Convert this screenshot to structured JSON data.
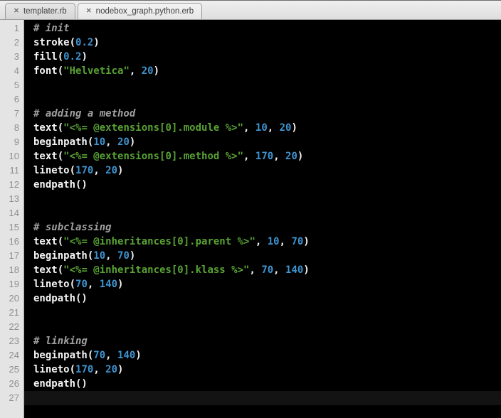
{
  "tabs": {
    "close_glyph": "✕",
    "items": [
      {
        "label": "templater.rb",
        "active": false
      },
      {
        "label": "nodebox_graph.python.erb",
        "active": true
      }
    ]
  },
  "editor": {
    "language": "nodebox-python-erb",
    "current_line": 27,
    "colors": {
      "bg": "#000000",
      "current_line_bg": "#131313",
      "gutter_bg": "#e4e4e4",
      "gutter_border": "#a6a6a6",
      "line_number": "#8f8f8f",
      "code_default": "#f5f5f5",
      "comment": "#a0a0a0",
      "string": "#58a234",
      "number": "#3e93cf"
    },
    "lines": [
      {
        "n": 1,
        "tokens": [
          {
            "t": "# init",
            "s": "comment"
          }
        ]
      },
      {
        "n": 2,
        "tokens": [
          {
            "t": "stroke(",
            "s": "plain"
          },
          {
            "t": "0.2",
            "s": "number"
          },
          {
            "t": ")",
            "s": "plain"
          }
        ]
      },
      {
        "n": 3,
        "tokens": [
          {
            "t": "fill(",
            "s": "plain"
          },
          {
            "t": "0.2",
            "s": "number"
          },
          {
            "t": ")",
            "s": "plain"
          }
        ]
      },
      {
        "n": 4,
        "tokens": [
          {
            "t": "font(",
            "s": "plain"
          },
          {
            "t": "\"Helvetica\"",
            "s": "string"
          },
          {
            "t": ", ",
            "s": "plain"
          },
          {
            "t": "20",
            "s": "number"
          },
          {
            "t": ")",
            "s": "plain"
          }
        ]
      },
      {
        "n": 5,
        "tokens": []
      },
      {
        "n": 6,
        "tokens": []
      },
      {
        "n": 7,
        "tokens": [
          {
            "t": "# adding a method",
            "s": "comment"
          }
        ]
      },
      {
        "n": 8,
        "tokens": [
          {
            "t": "text(",
            "s": "plain"
          },
          {
            "t": "\"<%= @extensions[0].module %>\"",
            "s": "string"
          },
          {
            "t": ", ",
            "s": "plain"
          },
          {
            "t": "10",
            "s": "number"
          },
          {
            "t": ", ",
            "s": "plain"
          },
          {
            "t": "20",
            "s": "number"
          },
          {
            "t": ")",
            "s": "plain"
          }
        ]
      },
      {
        "n": 9,
        "tokens": [
          {
            "t": "beginpath(",
            "s": "plain"
          },
          {
            "t": "10",
            "s": "number"
          },
          {
            "t": ", ",
            "s": "plain"
          },
          {
            "t": "20",
            "s": "number"
          },
          {
            "t": ")",
            "s": "plain"
          }
        ]
      },
      {
        "n": 10,
        "tokens": [
          {
            "t": "text(",
            "s": "plain"
          },
          {
            "t": "\"<%= @extensions[0].method %>\"",
            "s": "string"
          },
          {
            "t": ", ",
            "s": "plain"
          },
          {
            "t": "170",
            "s": "number"
          },
          {
            "t": ", ",
            "s": "plain"
          },
          {
            "t": "20",
            "s": "number"
          },
          {
            "t": ")",
            "s": "plain"
          }
        ]
      },
      {
        "n": 11,
        "tokens": [
          {
            "t": "lineto(",
            "s": "plain"
          },
          {
            "t": "170",
            "s": "number"
          },
          {
            "t": ", ",
            "s": "plain"
          },
          {
            "t": "20",
            "s": "number"
          },
          {
            "t": ")",
            "s": "plain"
          }
        ]
      },
      {
        "n": 12,
        "tokens": [
          {
            "t": "endpath()",
            "s": "plain"
          }
        ]
      },
      {
        "n": 13,
        "tokens": []
      },
      {
        "n": 14,
        "tokens": []
      },
      {
        "n": 15,
        "tokens": [
          {
            "t": "# subclassing",
            "s": "comment"
          }
        ]
      },
      {
        "n": 16,
        "tokens": [
          {
            "t": "text(",
            "s": "plain"
          },
          {
            "t": "\"<%= @inheritances[0].parent %>\"",
            "s": "string"
          },
          {
            "t": ", ",
            "s": "plain"
          },
          {
            "t": "10",
            "s": "number"
          },
          {
            "t": ", ",
            "s": "plain"
          },
          {
            "t": "70",
            "s": "number"
          },
          {
            "t": ")",
            "s": "plain"
          }
        ]
      },
      {
        "n": 17,
        "tokens": [
          {
            "t": "beginpath(",
            "s": "plain"
          },
          {
            "t": "10",
            "s": "number"
          },
          {
            "t": ", ",
            "s": "plain"
          },
          {
            "t": "70",
            "s": "number"
          },
          {
            "t": ")",
            "s": "plain"
          }
        ]
      },
      {
        "n": 18,
        "tokens": [
          {
            "t": "text(",
            "s": "plain"
          },
          {
            "t": "\"<%= @inheritances[0].klass %>\"",
            "s": "string"
          },
          {
            "t": ", ",
            "s": "plain"
          },
          {
            "t": "70",
            "s": "number"
          },
          {
            "t": ", ",
            "s": "plain"
          },
          {
            "t": "140",
            "s": "number"
          },
          {
            "t": ")",
            "s": "plain"
          }
        ]
      },
      {
        "n": 19,
        "tokens": [
          {
            "t": "lineto(",
            "s": "plain"
          },
          {
            "t": "70",
            "s": "number"
          },
          {
            "t": ", ",
            "s": "plain"
          },
          {
            "t": "140",
            "s": "number"
          },
          {
            "t": ")",
            "s": "plain"
          }
        ]
      },
      {
        "n": 20,
        "tokens": [
          {
            "t": "endpath()",
            "s": "plain"
          }
        ]
      },
      {
        "n": 21,
        "tokens": []
      },
      {
        "n": 22,
        "tokens": []
      },
      {
        "n": 23,
        "tokens": [
          {
            "t": "# linking",
            "s": "comment"
          }
        ]
      },
      {
        "n": 24,
        "tokens": [
          {
            "t": "beginpath(",
            "s": "plain"
          },
          {
            "t": "70",
            "s": "number"
          },
          {
            "t": ", ",
            "s": "plain"
          },
          {
            "t": "140",
            "s": "number"
          },
          {
            "t": ")",
            "s": "plain"
          }
        ]
      },
      {
        "n": 25,
        "tokens": [
          {
            "t": "lineto(",
            "s": "plain"
          },
          {
            "t": "170",
            "s": "number"
          },
          {
            "t": ", ",
            "s": "plain"
          },
          {
            "t": "20",
            "s": "number"
          },
          {
            "t": ")",
            "s": "plain"
          }
        ]
      },
      {
        "n": 26,
        "tokens": [
          {
            "t": "endpath()",
            "s": "plain"
          }
        ]
      },
      {
        "n": 27,
        "tokens": []
      }
    ]
  }
}
